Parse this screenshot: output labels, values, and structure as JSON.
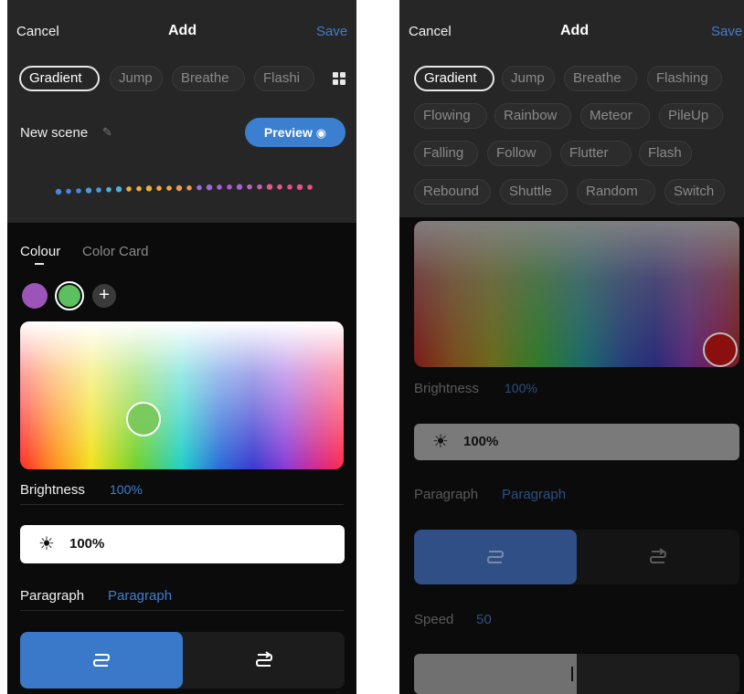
{
  "colors": {
    "accent": "#3b7fd0",
    "header_bg": "#262626",
    "screen_bg": "#0b0b0b",
    "swatch_purple": "#9b55b8",
    "swatch_green": "#5cc05f",
    "right_handle_color": "#8a1010"
  },
  "left": {
    "nav": {
      "cancel": "Cancel",
      "title": "Add",
      "save": "Save"
    },
    "modes": [
      "Gradient",
      "Jump",
      "Breathe",
      "Flashi"
    ],
    "active_mode": "Gradient",
    "grid_icon": "grid-icon",
    "scene_name": "New scene",
    "pencil_icon": "pencil-icon",
    "preview_label": "Preview",
    "preview_icon": "eye-icon",
    "color_tabs": {
      "colour": "Colour",
      "card": "Color Card"
    },
    "swatches": [
      "#9b55b8",
      "#5cc05f"
    ],
    "add_icon": "plus-icon",
    "brightness_label": "Brightness",
    "brightness_value": "100%",
    "brightness_bar_value": "100%",
    "sun_icon": "sun-icon",
    "paragraph_label": "Paragraph",
    "paragraph_value": "Paragraph",
    "segment_icons": [
      "direction-forward-icon",
      "direction-backward-icon"
    ],
    "segment_selected_index": 0
  },
  "right": {
    "nav": {
      "cancel": "Cancel",
      "title": "Add",
      "save": "Save"
    },
    "modes": [
      [
        "Gradient",
        "Jump",
        "Breathe",
        "Flashing"
      ],
      [
        "Flowing",
        "Rainbow",
        "Meteor",
        "PileUp"
      ],
      [
        "Falling",
        "Follow",
        "Flutter",
        "Flash"
      ],
      [
        "Rebound",
        "Shuttle",
        "Random",
        "Switch"
      ]
    ],
    "active_mode": "Gradient",
    "brightness_label": "Brightness",
    "brightness_value": "100%",
    "brightness_bar_value": "100%",
    "sun_icon": "sun-icon",
    "paragraph_label": "Paragraph",
    "paragraph_value": "Paragraph",
    "segment_icons": [
      "direction-forward-icon",
      "direction-backward-icon"
    ],
    "segment_selected_index": 0,
    "speed_label": "Speed",
    "speed_value": "50",
    "speed_fraction": 0.5
  }
}
